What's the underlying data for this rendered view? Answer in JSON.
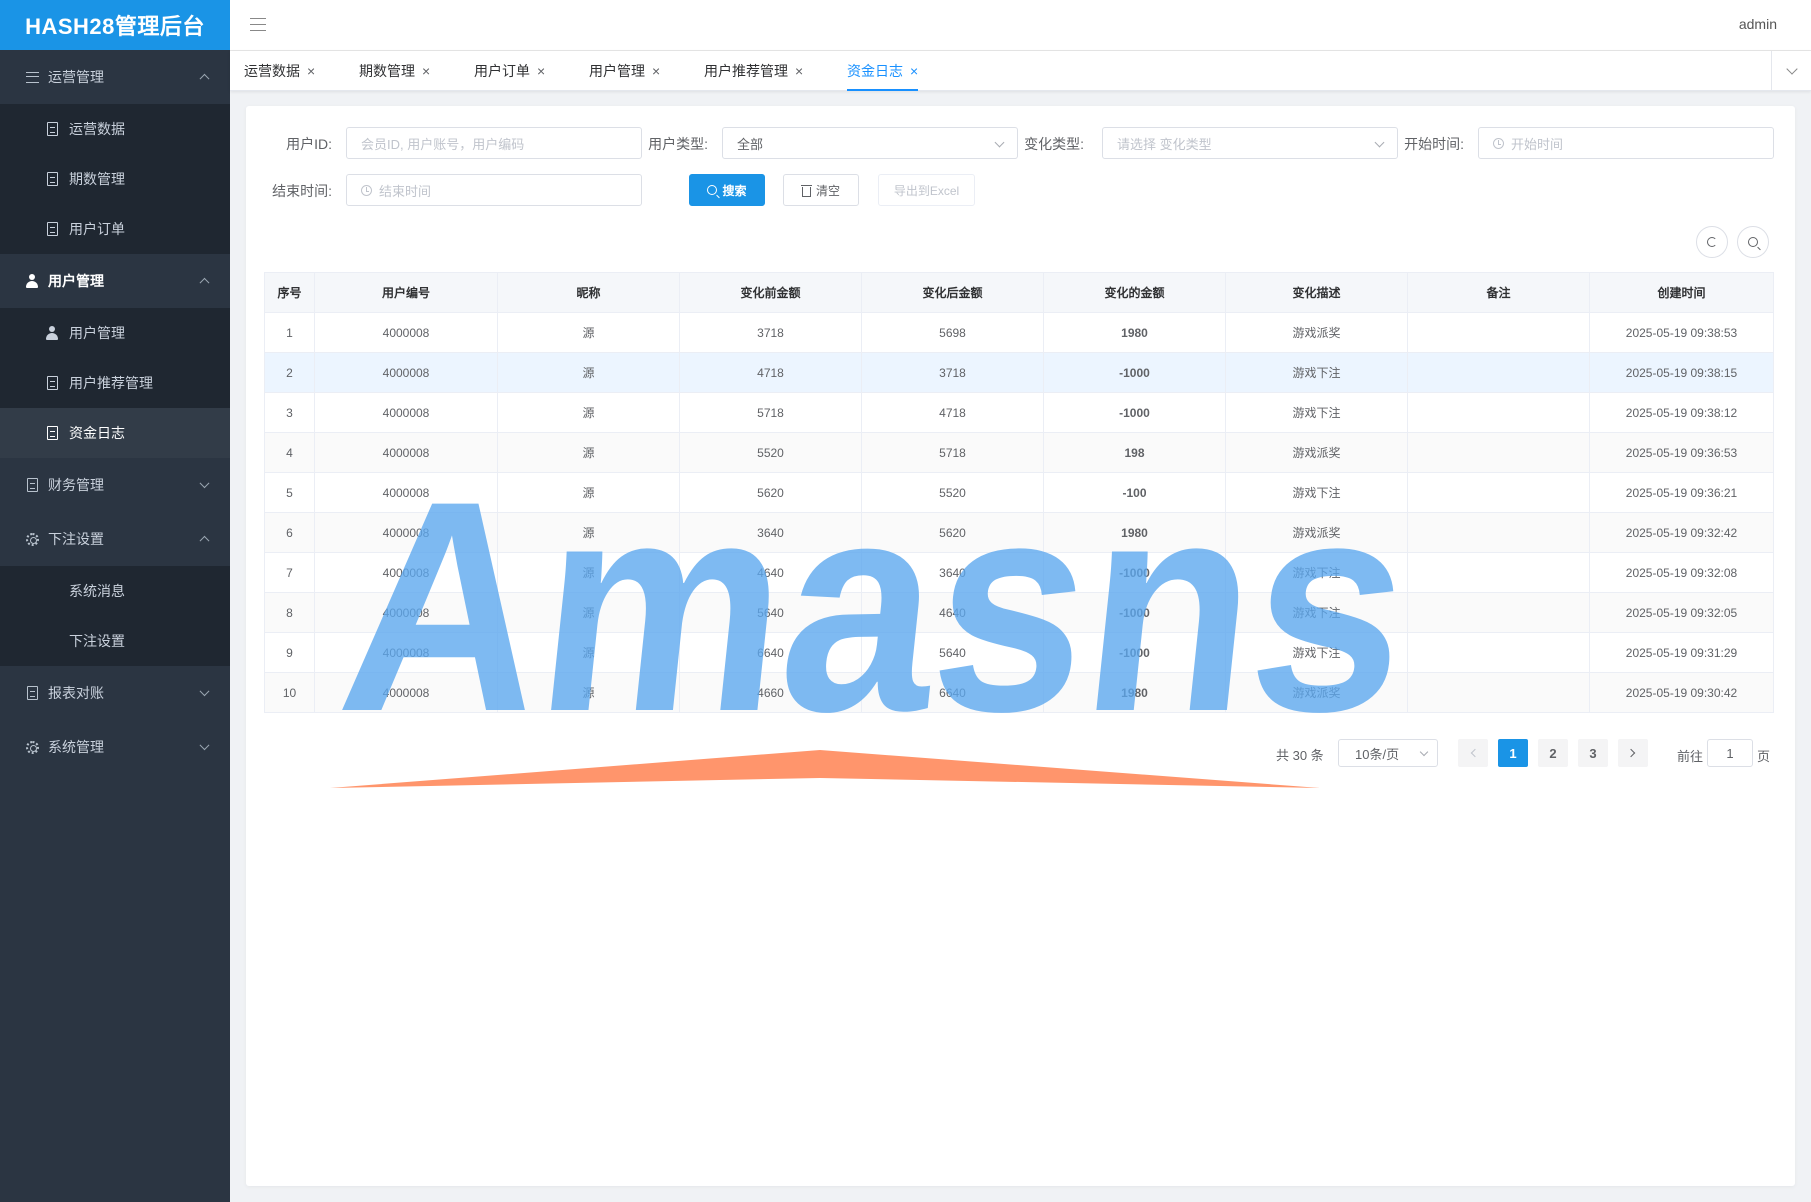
{
  "app": {
    "logo": "HASH28管理后台",
    "user": "admin"
  },
  "sidebar": {
    "groups": [
      {
        "label": "运营管理",
        "icon": "list-icon",
        "expanded": true,
        "items": [
          {
            "label": "运营数据",
            "icon": "document-icon"
          },
          {
            "label": "期数管理",
            "icon": "document-icon"
          },
          {
            "label": "用户订单",
            "icon": "document-icon"
          }
        ]
      },
      {
        "label": "用户管理",
        "icon": "user-icon",
        "expanded": true,
        "items": [
          {
            "label": "用户管理",
            "icon": "user-icon"
          },
          {
            "label": "用户推荐管理",
            "icon": "document-icon"
          },
          {
            "label": "资金日志",
            "icon": "document-icon",
            "active": true
          }
        ]
      },
      {
        "label": "财务管理",
        "icon": "document-icon",
        "expanded": false,
        "items": []
      },
      {
        "label": "下注设置",
        "icon": "gear-icon",
        "expanded": true,
        "items": [
          {
            "label": "系统消息"
          },
          {
            "label": "下注设置"
          }
        ]
      },
      {
        "label": "报表对账",
        "icon": "document-icon",
        "expanded": false,
        "items": []
      },
      {
        "label": "系统管理",
        "icon": "gear-icon",
        "expanded": false,
        "items": []
      }
    ]
  },
  "tabs": [
    {
      "label": "运营数据"
    },
    {
      "label": "期数管理"
    },
    {
      "label": "用户订单"
    },
    {
      "label": "用户管理"
    },
    {
      "label": "用户推荐管理"
    },
    {
      "label": "资金日志",
      "active": true
    }
  ],
  "filters": {
    "user_id": {
      "label": "用户ID:",
      "placeholder": "会员ID, 用户账号，用户编码"
    },
    "user_type": {
      "label": "用户类型:",
      "value": "全部"
    },
    "change_type": {
      "label": "变化类型:",
      "placeholder": "请选择 变化类型"
    },
    "start_time": {
      "label": "开始时间:",
      "placeholder": "开始时间"
    },
    "end_time": {
      "label": "结束时间:",
      "placeholder": "结束时间"
    },
    "search_button": "搜索",
    "clear_button": "清空",
    "export_button": "导出到Excel"
  },
  "table": {
    "columns": [
      "序号",
      "用户编号",
      "昵称",
      "变化前金额",
      "变化后金额",
      "变化的金额",
      "变化描述",
      "备注",
      "创建时间"
    ],
    "rows": [
      {
        "idx": "1",
        "uid": "4000008",
        "nick": "源",
        "before": "3718",
        "after": "5698",
        "delta": "1980",
        "sign": "pos",
        "desc": "游戏派奖",
        "note": "",
        "time": "2025-05-19 09:38:53"
      },
      {
        "idx": "2",
        "uid": "4000008",
        "nick": "源",
        "before": "4718",
        "after": "3718",
        "delta": "-1000",
        "sign": "neg",
        "desc": "游戏下注",
        "note": "",
        "time": "2025-05-19 09:38:15"
      },
      {
        "idx": "3",
        "uid": "4000008",
        "nick": "源",
        "before": "5718",
        "after": "4718",
        "delta": "-1000",
        "sign": "neg",
        "desc": "游戏下注",
        "note": "",
        "time": "2025-05-19 09:38:12"
      },
      {
        "idx": "4",
        "uid": "4000008",
        "nick": "源",
        "before": "5520",
        "after": "5718",
        "delta": "198",
        "sign": "pos",
        "desc": "游戏派奖",
        "note": "",
        "time": "2025-05-19 09:36:53"
      },
      {
        "idx": "5",
        "uid": "4000008",
        "nick": "源",
        "before": "5620",
        "after": "5520",
        "delta": "-100",
        "sign": "neg",
        "desc": "游戏下注",
        "note": "",
        "time": "2025-05-19 09:36:21"
      },
      {
        "idx": "6",
        "uid": "4000008",
        "nick": "源",
        "before": "3640",
        "after": "5620",
        "delta": "1980",
        "sign": "pos",
        "desc": "游戏派奖",
        "note": "",
        "time": "2025-05-19 09:32:42"
      },
      {
        "idx": "7",
        "uid": "4000008",
        "nick": "源",
        "before": "4640",
        "after": "3640",
        "delta": "-1000",
        "sign": "neg",
        "desc": "游戏下注",
        "note": "",
        "time": "2025-05-19 09:32:08"
      },
      {
        "idx": "8",
        "uid": "4000008",
        "nick": "源",
        "before": "5640",
        "after": "4640",
        "delta": "-1000",
        "sign": "neg",
        "desc": "游戏下注",
        "note": "",
        "time": "2025-05-19 09:32:05"
      },
      {
        "idx": "9",
        "uid": "4000008",
        "nick": "源",
        "before": "6640",
        "after": "5640",
        "delta": "-1000",
        "sign": "neg",
        "desc": "游戏下注",
        "note": "",
        "time": "2025-05-19 09:31:29"
      },
      {
        "idx": "10",
        "uid": "4000008",
        "nick": "源",
        "before": "4660",
        "after": "6640",
        "delta": "1980",
        "sign": "pos",
        "desc": "游戏派奖",
        "note": "",
        "time": "2025-05-19 09:30:42"
      }
    ]
  },
  "pagination": {
    "total": "共 30 条",
    "page_size": "10条/页",
    "pages": [
      "1",
      "2",
      "3"
    ],
    "current_page": "1",
    "goto_label": "前往",
    "goto_value": "1",
    "page_suffix": "页"
  },
  "watermark": {
    "text": "Amasns",
    "color": "#5aa7ee",
    "accent": "#ff8a5c"
  },
  "colors": {
    "primary": "#1a94e6",
    "sidebar": "#2b3542",
    "positive": "#d21e1e",
    "negative": "#1e9b4b"
  }
}
